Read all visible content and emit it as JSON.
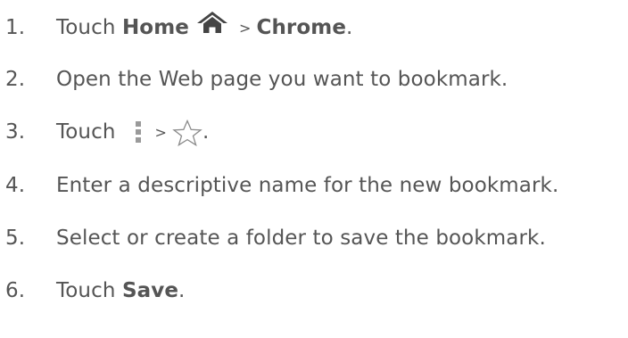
{
  "steps": [
    {
      "number": "1.",
      "touch": "Touch",
      "home": "Home",
      "separator": ">",
      "chrome": "Chrome",
      "end": "."
    },
    {
      "number": "2.",
      "text": "Open the Web page you want to bookmark."
    },
    {
      "number": "3.",
      "touch": "Touch",
      "separator": ">",
      "end": "."
    },
    {
      "number": "4.",
      "text": "Enter a descriptive name for the new bookmark."
    },
    {
      "number": "5.",
      "text": "Select or create a folder to save the bookmark."
    },
    {
      "number": "6.",
      "touch": "Touch",
      "save": "Save",
      "end": "."
    }
  ],
  "icons": {
    "home": "home-icon",
    "menu": "vertical-menu-icon",
    "star": "star-outline-icon"
  }
}
